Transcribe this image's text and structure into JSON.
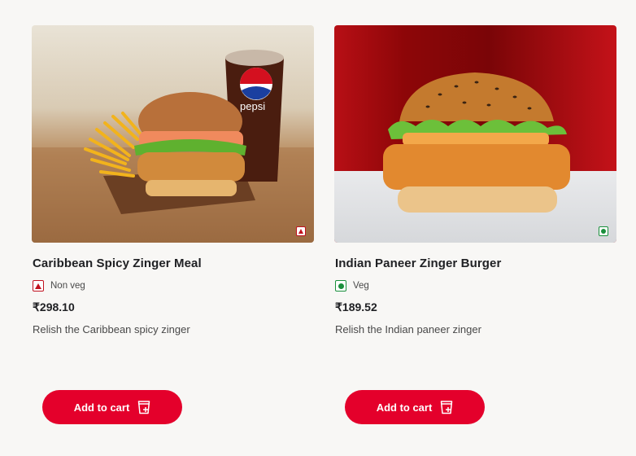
{
  "products": [
    {
      "name": "Caribbean Spicy Zinger Meal",
      "diet_label": "Non veg",
      "diet_type": "non-veg",
      "price": "₹298.10",
      "description": "Relish the Caribbean spicy zinger",
      "button_label": "Add to cart",
      "image_text": "pepsi"
    },
    {
      "name": "Indian Paneer Zinger Burger",
      "diet_label": "Veg",
      "diet_type": "veg",
      "price": "₹189.52",
      "description": "Relish the Indian paneer zinger",
      "button_label": "Add to cart"
    }
  ],
  "colors": {
    "accent": "#e4002b",
    "non_veg": "#c1121f",
    "veg": "#1a8f3c",
    "background": "#f8f7f5"
  }
}
